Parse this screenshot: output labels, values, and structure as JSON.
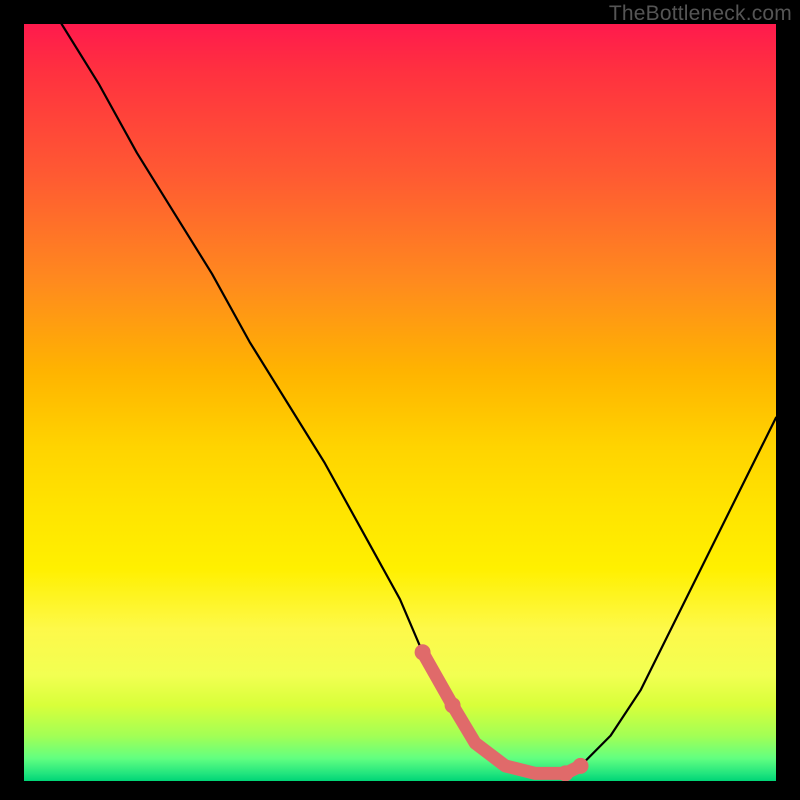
{
  "watermark": "TheBottleneck.com",
  "chart_data": {
    "type": "line",
    "title": "",
    "xlabel": "",
    "ylabel": "",
    "xlim": [
      0,
      100
    ],
    "ylim": [
      0,
      100
    ],
    "grid": false,
    "legend": false,
    "background": {
      "gradient_stops": [
        {
          "pos": 0,
          "color": "#ff1a4d"
        },
        {
          "pos": 20,
          "color": "#ff5a32"
        },
        {
          "pos": 46,
          "color": "#ffb400"
        },
        {
          "pos": 72,
          "color": "#fff000"
        },
        {
          "pos": 90,
          "color": "#d8ff3a"
        },
        {
          "pos": 100,
          "color": "#00d477"
        }
      ]
    },
    "series": [
      {
        "name": "bottleneck-curve",
        "color": "#000000",
        "x": [
          5,
          10,
          15,
          20,
          25,
          30,
          35,
          40,
          45,
          50,
          53,
          57,
          60,
          64,
          68,
          72,
          74,
          78,
          82,
          86,
          90,
          95,
          100
        ],
        "values": [
          100,
          92,
          83,
          75,
          67,
          58,
          50,
          42,
          33,
          24,
          17,
          10,
          5,
          2,
          1,
          1,
          2,
          6,
          12,
          20,
          28,
          38,
          48
        ]
      },
      {
        "name": "optimal-range-accent",
        "color": "#e06a6a",
        "x": [
          53,
          57,
          60,
          64,
          68,
          72,
          74
        ],
        "values": [
          17,
          10,
          5,
          2,
          1,
          1,
          2
        ]
      }
    ],
    "annotations": []
  }
}
